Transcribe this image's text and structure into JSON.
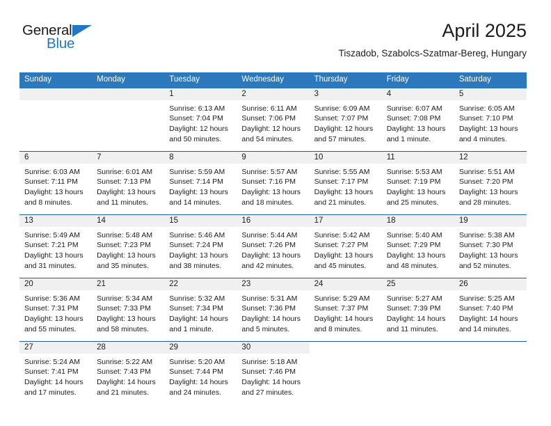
{
  "brand": {
    "name_top": "General",
    "name_bottom": "Blue",
    "accent_color": "#1f78c1"
  },
  "header": {
    "month_title": "April 2025",
    "location": "Tiszadob, Szabolcs-Szatmar-Bereg, Hungary"
  },
  "theme": {
    "header_blue": "#2c78bd",
    "row_divider_blue": "#1a5fa0",
    "date_band_gray": "#f0f0f0"
  },
  "calendar": {
    "day_headers": [
      "Sunday",
      "Monday",
      "Tuesday",
      "Wednesday",
      "Thursday",
      "Friday",
      "Saturday"
    ],
    "weeks": [
      [
        {
          "day": "",
          "empty": true
        },
        {
          "day": "",
          "empty": true
        },
        {
          "day": "1",
          "sunrise": "Sunrise: 6:13 AM",
          "sunset": "Sunset: 7:04 PM",
          "daylight": "Daylight: 12 hours and 50 minutes."
        },
        {
          "day": "2",
          "sunrise": "Sunrise: 6:11 AM",
          "sunset": "Sunset: 7:06 PM",
          "daylight": "Daylight: 12 hours and 54 minutes."
        },
        {
          "day": "3",
          "sunrise": "Sunrise: 6:09 AM",
          "sunset": "Sunset: 7:07 PM",
          "daylight": "Daylight: 12 hours and 57 minutes."
        },
        {
          "day": "4",
          "sunrise": "Sunrise: 6:07 AM",
          "sunset": "Sunset: 7:08 PM",
          "daylight": "Daylight: 13 hours and 1 minute."
        },
        {
          "day": "5",
          "sunrise": "Sunrise: 6:05 AM",
          "sunset": "Sunset: 7:10 PM",
          "daylight": "Daylight: 13 hours and 4 minutes."
        }
      ],
      [
        {
          "day": "6",
          "sunrise": "Sunrise: 6:03 AM",
          "sunset": "Sunset: 7:11 PM",
          "daylight": "Daylight: 13 hours and 8 minutes."
        },
        {
          "day": "7",
          "sunrise": "Sunrise: 6:01 AM",
          "sunset": "Sunset: 7:13 PM",
          "daylight": "Daylight: 13 hours and 11 minutes."
        },
        {
          "day": "8",
          "sunrise": "Sunrise: 5:59 AM",
          "sunset": "Sunset: 7:14 PM",
          "daylight": "Daylight: 13 hours and 14 minutes."
        },
        {
          "day": "9",
          "sunrise": "Sunrise: 5:57 AM",
          "sunset": "Sunset: 7:16 PM",
          "daylight": "Daylight: 13 hours and 18 minutes."
        },
        {
          "day": "10",
          "sunrise": "Sunrise: 5:55 AM",
          "sunset": "Sunset: 7:17 PM",
          "daylight": "Daylight: 13 hours and 21 minutes."
        },
        {
          "day": "11",
          "sunrise": "Sunrise: 5:53 AM",
          "sunset": "Sunset: 7:19 PM",
          "daylight": "Daylight: 13 hours and 25 minutes."
        },
        {
          "day": "12",
          "sunrise": "Sunrise: 5:51 AM",
          "sunset": "Sunset: 7:20 PM",
          "daylight": "Daylight: 13 hours and 28 minutes."
        }
      ],
      [
        {
          "day": "13",
          "sunrise": "Sunrise: 5:49 AM",
          "sunset": "Sunset: 7:21 PM",
          "daylight": "Daylight: 13 hours and 31 minutes."
        },
        {
          "day": "14",
          "sunrise": "Sunrise: 5:48 AM",
          "sunset": "Sunset: 7:23 PM",
          "daylight": "Daylight: 13 hours and 35 minutes."
        },
        {
          "day": "15",
          "sunrise": "Sunrise: 5:46 AM",
          "sunset": "Sunset: 7:24 PM",
          "daylight": "Daylight: 13 hours and 38 minutes."
        },
        {
          "day": "16",
          "sunrise": "Sunrise: 5:44 AM",
          "sunset": "Sunset: 7:26 PM",
          "daylight": "Daylight: 13 hours and 42 minutes."
        },
        {
          "day": "17",
          "sunrise": "Sunrise: 5:42 AM",
          "sunset": "Sunset: 7:27 PM",
          "daylight": "Daylight: 13 hours and 45 minutes."
        },
        {
          "day": "18",
          "sunrise": "Sunrise: 5:40 AM",
          "sunset": "Sunset: 7:29 PM",
          "daylight": "Daylight: 13 hours and 48 minutes."
        },
        {
          "day": "19",
          "sunrise": "Sunrise: 5:38 AM",
          "sunset": "Sunset: 7:30 PM",
          "daylight": "Daylight: 13 hours and 52 minutes."
        }
      ],
      [
        {
          "day": "20",
          "sunrise": "Sunrise: 5:36 AM",
          "sunset": "Sunset: 7:31 PM",
          "daylight": "Daylight: 13 hours and 55 minutes."
        },
        {
          "day": "21",
          "sunrise": "Sunrise: 5:34 AM",
          "sunset": "Sunset: 7:33 PM",
          "daylight": "Daylight: 13 hours and 58 minutes."
        },
        {
          "day": "22",
          "sunrise": "Sunrise: 5:32 AM",
          "sunset": "Sunset: 7:34 PM",
          "daylight": "Daylight: 14 hours and 1 minute."
        },
        {
          "day": "23",
          "sunrise": "Sunrise: 5:31 AM",
          "sunset": "Sunset: 7:36 PM",
          "daylight": "Daylight: 14 hours and 5 minutes."
        },
        {
          "day": "24",
          "sunrise": "Sunrise: 5:29 AM",
          "sunset": "Sunset: 7:37 PM",
          "daylight": "Daylight: 14 hours and 8 minutes."
        },
        {
          "day": "25",
          "sunrise": "Sunrise: 5:27 AM",
          "sunset": "Sunset: 7:39 PM",
          "daylight": "Daylight: 14 hours and 11 minutes."
        },
        {
          "day": "26",
          "sunrise": "Sunrise: 5:25 AM",
          "sunset": "Sunset: 7:40 PM",
          "daylight": "Daylight: 14 hours and 14 minutes."
        }
      ],
      [
        {
          "day": "27",
          "sunrise": "Sunrise: 5:24 AM",
          "sunset": "Sunset: 7:41 PM",
          "daylight": "Daylight: 14 hours and 17 minutes."
        },
        {
          "day": "28",
          "sunrise": "Sunrise: 5:22 AM",
          "sunset": "Sunset: 7:43 PM",
          "daylight": "Daylight: 14 hours and 21 minutes."
        },
        {
          "day": "29",
          "sunrise": "Sunrise: 5:20 AM",
          "sunset": "Sunset: 7:44 PM",
          "daylight": "Daylight: 14 hours and 24 minutes."
        },
        {
          "day": "30",
          "sunrise": "Sunrise: 5:18 AM",
          "sunset": "Sunset: 7:46 PM",
          "daylight": "Daylight: 14 hours and 27 minutes."
        },
        {
          "day": "",
          "empty": true,
          "blank": true
        },
        {
          "day": "",
          "empty": true,
          "blank": true
        },
        {
          "day": "",
          "empty": true,
          "blank": true
        }
      ]
    ]
  }
}
